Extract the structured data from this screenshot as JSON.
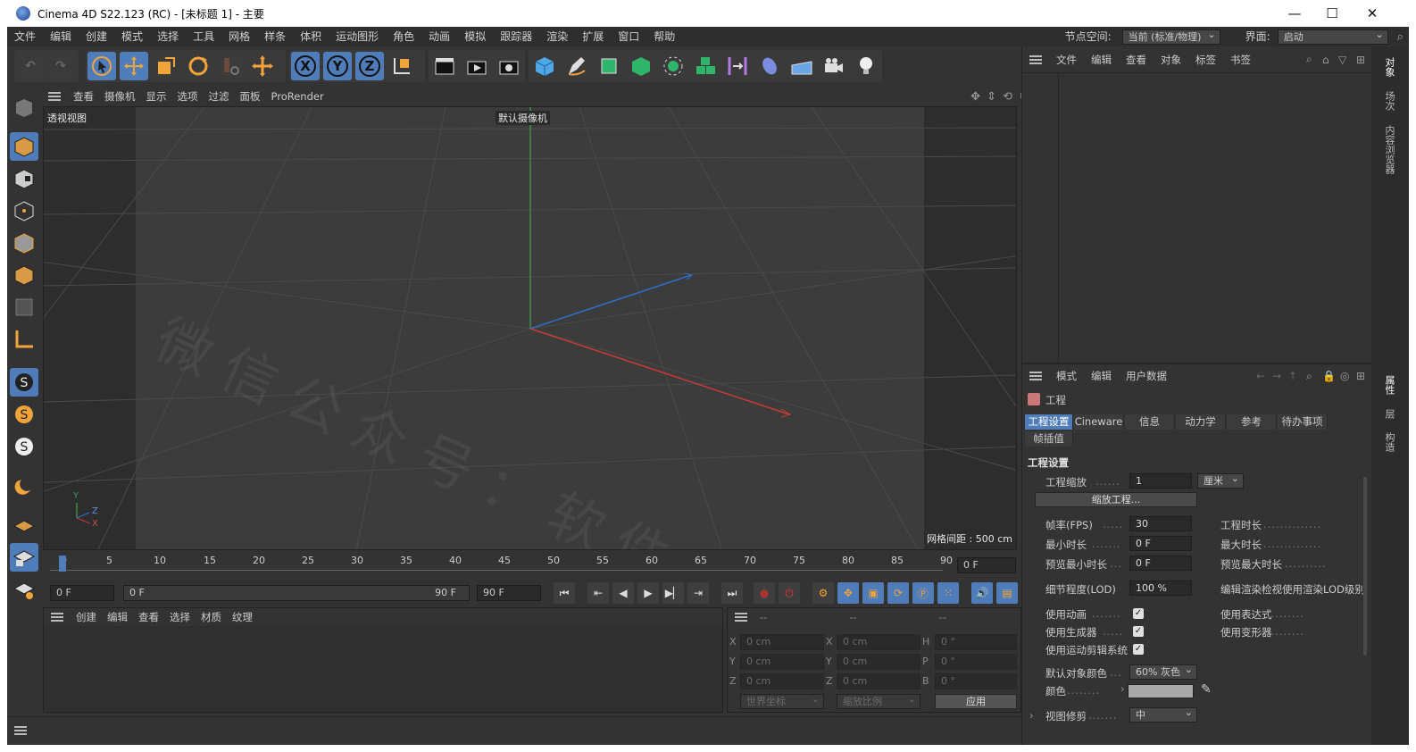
{
  "window": {
    "title": "Cinema 4D S22.123 (RC) - [未标题 1] - 主要",
    "buttons": {
      "minimize": "—",
      "maximize": "☐",
      "close": "✕"
    }
  },
  "menubar": {
    "items": [
      "文件",
      "编辑",
      "创建",
      "模式",
      "选择",
      "工具",
      "网格",
      "样条",
      "体积",
      "运动图形",
      "角色",
      "动画",
      "模拟",
      "跟踪器",
      "渲染",
      "扩展",
      "窗口",
      "帮助"
    ],
    "node_space_label": "节点空间:",
    "node_space_value": "当前 (标准/物理)",
    "layout_label": "界面:",
    "layout_value": "启动"
  },
  "toolbar": {
    "axis_x": "X",
    "axis_y": "Y",
    "axis_z": "Z"
  },
  "viewport": {
    "menu": [
      "查看",
      "摄像机",
      "显示",
      "选项",
      "过滤",
      "面板",
      "ProRender"
    ],
    "view_name": "透视视图",
    "camera_name": "默认摄像机",
    "grid_spacing": "网格间距 : 500 cm",
    "axis_labels": {
      "y": "Y",
      "z": "Z",
      "x": "X"
    },
    "watermark": "微信公众号：软件安装大师"
  },
  "timeline": {
    "ticks": [
      "0",
      "5",
      "10",
      "15",
      "20",
      "25",
      "30",
      "35",
      "40",
      "45",
      "50",
      "55",
      "60",
      "65",
      "70",
      "75",
      "80",
      "85",
      "90"
    ],
    "current_frame": "0 F",
    "start": "0 F",
    "range_start": "0 F",
    "range_end": "90 F",
    "end": "90 F"
  },
  "material_panel": {
    "menu": [
      "创建",
      "编辑",
      "查看",
      "选择",
      "材质",
      "纹理"
    ]
  },
  "coord_panel": {
    "headers": [
      "--",
      "--",
      "--"
    ],
    "rows": [
      {
        "l1": "X",
        "v1": "0 cm",
        "l2": "X",
        "v2": "0 cm",
        "l3": "H",
        "v3": "0 °"
      },
      {
        "l1": "Y",
        "v1": "0 cm",
        "l2": "Y",
        "v2": "0 cm",
        "l3": "P",
        "v3": "0 °"
      },
      {
        "l1": "Z",
        "v1": "0 cm",
        "l2": "Z",
        "v2": "0 cm",
        "l3": "B",
        "v3": "0 °"
      }
    ],
    "world_coord": "世界坐标",
    "scale": "缩放比例",
    "apply": "应用"
  },
  "object_panel": {
    "menu": [
      "文件",
      "编辑",
      "查看",
      "对象",
      "标签",
      "书签"
    ]
  },
  "attr_panel": {
    "menu": [
      "模式",
      "编辑",
      "用户数据"
    ],
    "object_name": "工程",
    "tabs": [
      "工程设置",
      "Cineware",
      "信息",
      "动力学",
      "参考",
      "待办事项",
      "帧插值"
    ],
    "section_title": "工程设置",
    "project_scale_label": "工程缩放",
    "project_scale_value": "1",
    "project_scale_unit": "厘米",
    "scale_project_button": "缩放工程...",
    "fps_label": "帧率(FPS)",
    "fps_value": "30",
    "project_time_label": "工程时长",
    "min_time_label": "最小时长",
    "min_time_value": "0 F",
    "max_time_label": "最大时长",
    "preview_min_label": "预览最小时长",
    "preview_min_value": "0 F",
    "preview_max_label": "预览最大时长",
    "lod_label": "细节程度(LOD)",
    "lod_value": "100 %",
    "lod_render_label": "编辑渲染检视使用渲染LOD级别",
    "use_animation": "使用动画",
    "use_expressions": "使用表达式",
    "use_generators": "使用生成器",
    "use_deformers": "使用变形器",
    "use_motion_system": "使用运动剪辑系统",
    "default_color_label": "默认对象颜色",
    "default_color_value": "60% 灰色",
    "color_label": "颜色",
    "view_clip_label": "视图修剪",
    "view_clip_value": "中",
    "color_swatch": "#a8a8a8",
    "accent": "#4e7dba"
  },
  "right_strip": {
    "tabs": [
      "对象",
      "场次",
      "内容浏览器",
      "属性",
      "层",
      "构造"
    ]
  }
}
